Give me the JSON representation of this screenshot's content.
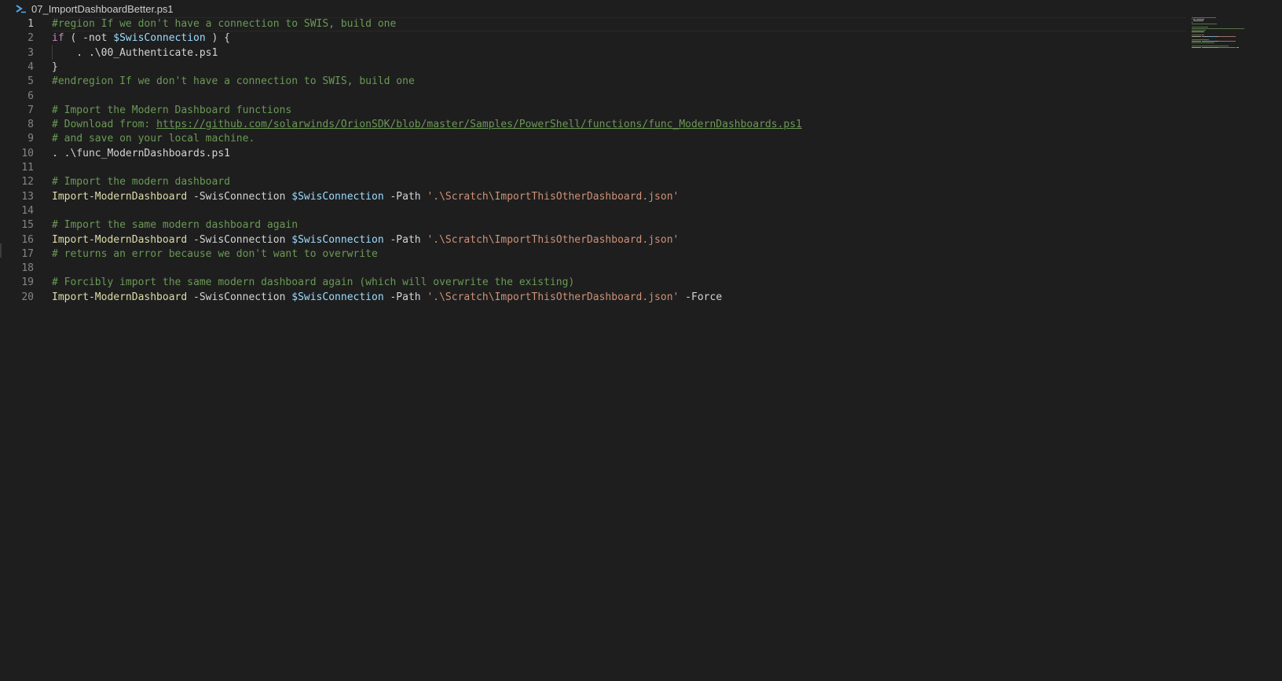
{
  "tab": {
    "file_name": "07_ImportDashboardBetter.ps1",
    "icon": "powershell-icon"
  },
  "colors": {
    "background": "#1e1e1e",
    "comment": "#6a9955",
    "keyword": "#c586c0",
    "variable": "#9cdcfe",
    "string": "#ce9178",
    "function": "#dcdcaa",
    "text": "#d4d4d4",
    "line_number": "#858585",
    "icon_accent": "#4fa6e8"
  },
  "editor": {
    "active_line": 1,
    "lines": [
      {
        "num": "1",
        "tokens": [
          {
            "t": "#region If we don't have a connection to SWIS, build one",
            "c": "comment"
          }
        ]
      },
      {
        "num": "2",
        "tokens": [
          {
            "t": "if",
            "c": "keyword"
          },
          {
            "t": " ( -not ",
            "c": "plain"
          },
          {
            "t": "$SwisConnection",
            "c": "variable"
          },
          {
            "t": " ) {",
            "c": "plain"
          }
        ]
      },
      {
        "num": "3",
        "tokens": [
          {
            "t": "    . .\\00_Authenticate.ps1",
            "c": "plain"
          }
        ]
      },
      {
        "num": "4",
        "tokens": [
          {
            "t": "}",
            "c": "plain"
          }
        ]
      },
      {
        "num": "5",
        "tokens": [
          {
            "t": "#endregion If we don't have a connection to SWIS, build one",
            "c": "comment"
          }
        ]
      },
      {
        "num": "6",
        "tokens": []
      },
      {
        "num": "7",
        "tokens": [
          {
            "t": "# Import the Modern Dashboard functions",
            "c": "comment"
          }
        ]
      },
      {
        "num": "8",
        "tokens": [
          {
            "t": "# Download from: ",
            "c": "comment"
          },
          {
            "t": "https://github.com/solarwinds/OrionSDK/blob/master/Samples/PowerShell/functions/func_ModernDashboards.ps1",
            "c": "link"
          }
        ]
      },
      {
        "num": "9",
        "tokens": [
          {
            "t": "# and save on your local machine.",
            "c": "comment"
          }
        ]
      },
      {
        "num": "10",
        "tokens": [
          {
            "t": ". .\\func_ModernDashboards.ps1",
            "c": "plain"
          }
        ]
      },
      {
        "num": "11",
        "tokens": []
      },
      {
        "num": "12",
        "tokens": [
          {
            "t": "# Import the modern dashboard",
            "c": "comment"
          }
        ]
      },
      {
        "num": "13",
        "tokens": [
          {
            "t": "Import-ModernDashboard",
            "c": "function"
          },
          {
            "t": " -SwisConnection ",
            "c": "plain"
          },
          {
            "t": "$SwisConnection",
            "c": "variable"
          },
          {
            "t": " -Path ",
            "c": "plain"
          },
          {
            "t": "'.\\Scratch\\ImportThisOtherDashboard.json'",
            "c": "string"
          }
        ]
      },
      {
        "num": "14",
        "tokens": []
      },
      {
        "num": "15",
        "tokens": [
          {
            "t": "# Import the same modern dashboard again",
            "c": "comment"
          }
        ]
      },
      {
        "num": "16",
        "tokens": [
          {
            "t": "Import-ModernDashboard",
            "c": "function"
          },
          {
            "t": " -SwisConnection ",
            "c": "plain"
          },
          {
            "t": "$SwisConnection",
            "c": "variable"
          },
          {
            "t": " -Path ",
            "c": "plain"
          },
          {
            "t": "'.\\Scratch\\ImportThisOtherDashboard.json'",
            "c": "string"
          }
        ]
      },
      {
        "num": "17",
        "tokens": [
          {
            "t": "# returns an error because we don't want to overwrite",
            "c": "comment"
          }
        ]
      },
      {
        "num": "18",
        "tokens": []
      },
      {
        "num": "19",
        "tokens": [
          {
            "t": "# Forcibly import the same modern dashboard again (which will overwrite the existing)",
            "c": "comment"
          }
        ]
      },
      {
        "num": "20",
        "tokens": [
          {
            "t": "Import-ModernDashboard",
            "c": "function"
          },
          {
            "t": " -SwisConnection ",
            "c": "plain"
          },
          {
            "t": "$SwisConnection",
            "c": "variable"
          },
          {
            "t": " -Path ",
            "c": "plain"
          },
          {
            "t": "'.\\Scratch\\ImportThisOtherDashboard.json'",
            "c": "string"
          },
          {
            "t": " -Force",
            "c": "plain"
          }
        ]
      }
    ]
  }
}
